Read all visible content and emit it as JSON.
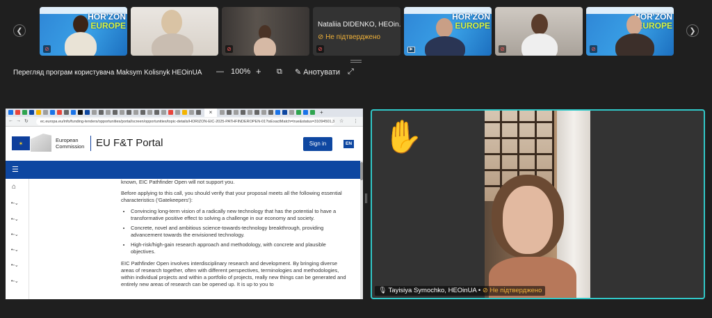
{
  "participants": [
    {
      "id": "p1",
      "name": "",
      "muted": true
    },
    {
      "id": "p2",
      "name": "",
      "muted": false
    },
    {
      "id": "p3",
      "name": "",
      "muted": true
    },
    {
      "id": "p4",
      "name": "Nataliia DIDENKO, HEOin...",
      "status": "⊘ Не підтверджено",
      "muted": true
    },
    {
      "id": "p5",
      "name": "",
      "muted": false,
      "sharing": true
    },
    {
      "id": "p6",
      "name": "",
      "muted": true
    },
    {
      "id": "p7",
      "name": "",
      "muted": true
    }
  ],
  "horizon_logo": {
    "line1": "HOR'ZON",
    "line2": "EUROPE"
  },
  "toolbar": {
    "title": "Перегляд програм користувача Maksym Kolisnyk HEOinUA",
    "zoom_out": "—",
    "zoom": "100%",
    "zoom_in": "+",
    "annotate": "Анотувати"
  },
  "browser": {
    "url": "ec.europa.eu/info/funding-tenders/opportunities/portal/screen/opportunities/topic-details/HORIZON-EIC-2025-PATHFINDEROPEN-01?isExactMatch=true&status=31094501,31094502&frameworkPr..."
  },
  "portal": {
    "org_line1": "European",
    "org_line2": "Commission",
    "title": "EU F&T Portal",
    "signin": "Sign in",
    "lang": "EN"
  },
  "content": {
    "p0": "known, EIC Pathfinder Open will not support you.",
    "p1": "Before applying to this call, you should verify that your proposal meets all the following essential characteristics ('Gatekeepers'):",
    "bullets": [
      "Convincing long-term vision of a radically new technology that has the potential to have a transformative positive effect to solving a challenge in our economy and society.",
      "Concrete, novel and ambitious science-towards-technology breakthrough, providing advancement towards the envisioned technology.",
      "High-risk/high-gain research approach and methodology, with concrete and plausible objectives."
    ],
    "p2": "EIC Pathfinder Open involves interdisciplinary research and development. By bringing diverse areas of research together, often with different perspectives, terminologies and methodologies, within individual projects and within a portfolio of projects, really new things can be generated and entirely new areas of research can be opened up. It is up to you to"
  },
  "speaker": {
    "name": "Tayisiya Symochko, HEOinUA",
    "separator": "•",
    "status": "⊘ Не підтверджено",
    "hand": "✋"
  },
  "colors": {
    "accent": "#31c9c9",
    "unverified": "#f0b23a",
    "ec_blue": "#0e47a1"
  }
}
